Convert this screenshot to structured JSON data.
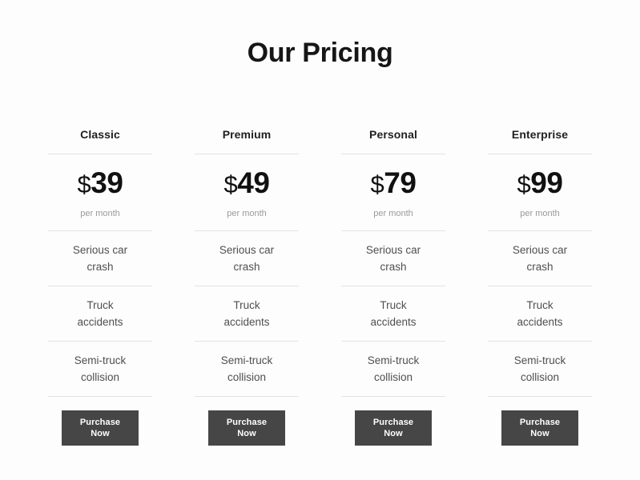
{
  "section": {
    "title": "Our Pricing"
  },
  "theme": {
    "background": "#fdfdfd",
    "title_color": "#161616",
    "plan_name_color": "#1f1f1f",
    "price_color": "#111111",
    "period_color": "#9a9a9a",
    "feature_color": "#4f4f4f",
    "divider_color": "#e2e2e2",
    "button_background": "#464646",
    "button_text_color": "#ffffff"
  },
  "currency_symbol": "$",
  "period_label": "per month",
  "cta": {
    "line1": "Purchase",
    "line2": "Now"
  },
  "plans": [
    {
      "name": "Classic",
      "currency": "$",
      "price": "39",
      "period": "per month",
      "features": [
        {
          "line1": "Serious car",
          "line2": "crash"
        },
        {
          "line1": "Truck",
          "line2": "accidents"
        },
        {
          "line1": "Semi-truck",
          "line2": "collision"
        }
      ],
      "cta_line1": "Purchase",
      "cta_line2": "Now"
    },
    {
      "name": "Premium",
      "currency": "$",
      "price": "49",
      "period": "per month",
      "features": [
        {
          "line1": "Serious car",
          "line2": "crash"
        },
        {
          "line1": "Truck",
          "line2": "accidents"
        },
        {
          "line1": "Semi-truck",
          "line2": "collision"
        }
      ],
      "cta_line1": "Purchase",
      "cta_line2": "Now"
    },
    {
      "name": "Personal",
      "currency": "$",
      "price": "79",
      "period": "per month",
      "features": [
        {
          "line1": "Serious car",
          "line2": "crash"
        },
        {
          "line1": "Truck",
          "line2": "accidents"
        },
        {
          "line1": "Semi-truck",
          "line2": "collision"
        }
      ],
      "cta_line1": "Purchase",
      "cta_line2": "Now"
    },
    {
      "name": "Enterprise",
      "currency": "$",
      "price": "99",
      "period": "per month",
      "features": [
        {
          "line1": "Serious car",
          "line2": "crash"
        },
        {
          "line1": "Truck",
          "line2": "accidents"
        },
        {
          "line1": "Semi-truck",
          "line2": "collision"
        }
      ],
      "cta_line1": "Purchase",
      "cta_line2": "Now"
    }
  ]
}
